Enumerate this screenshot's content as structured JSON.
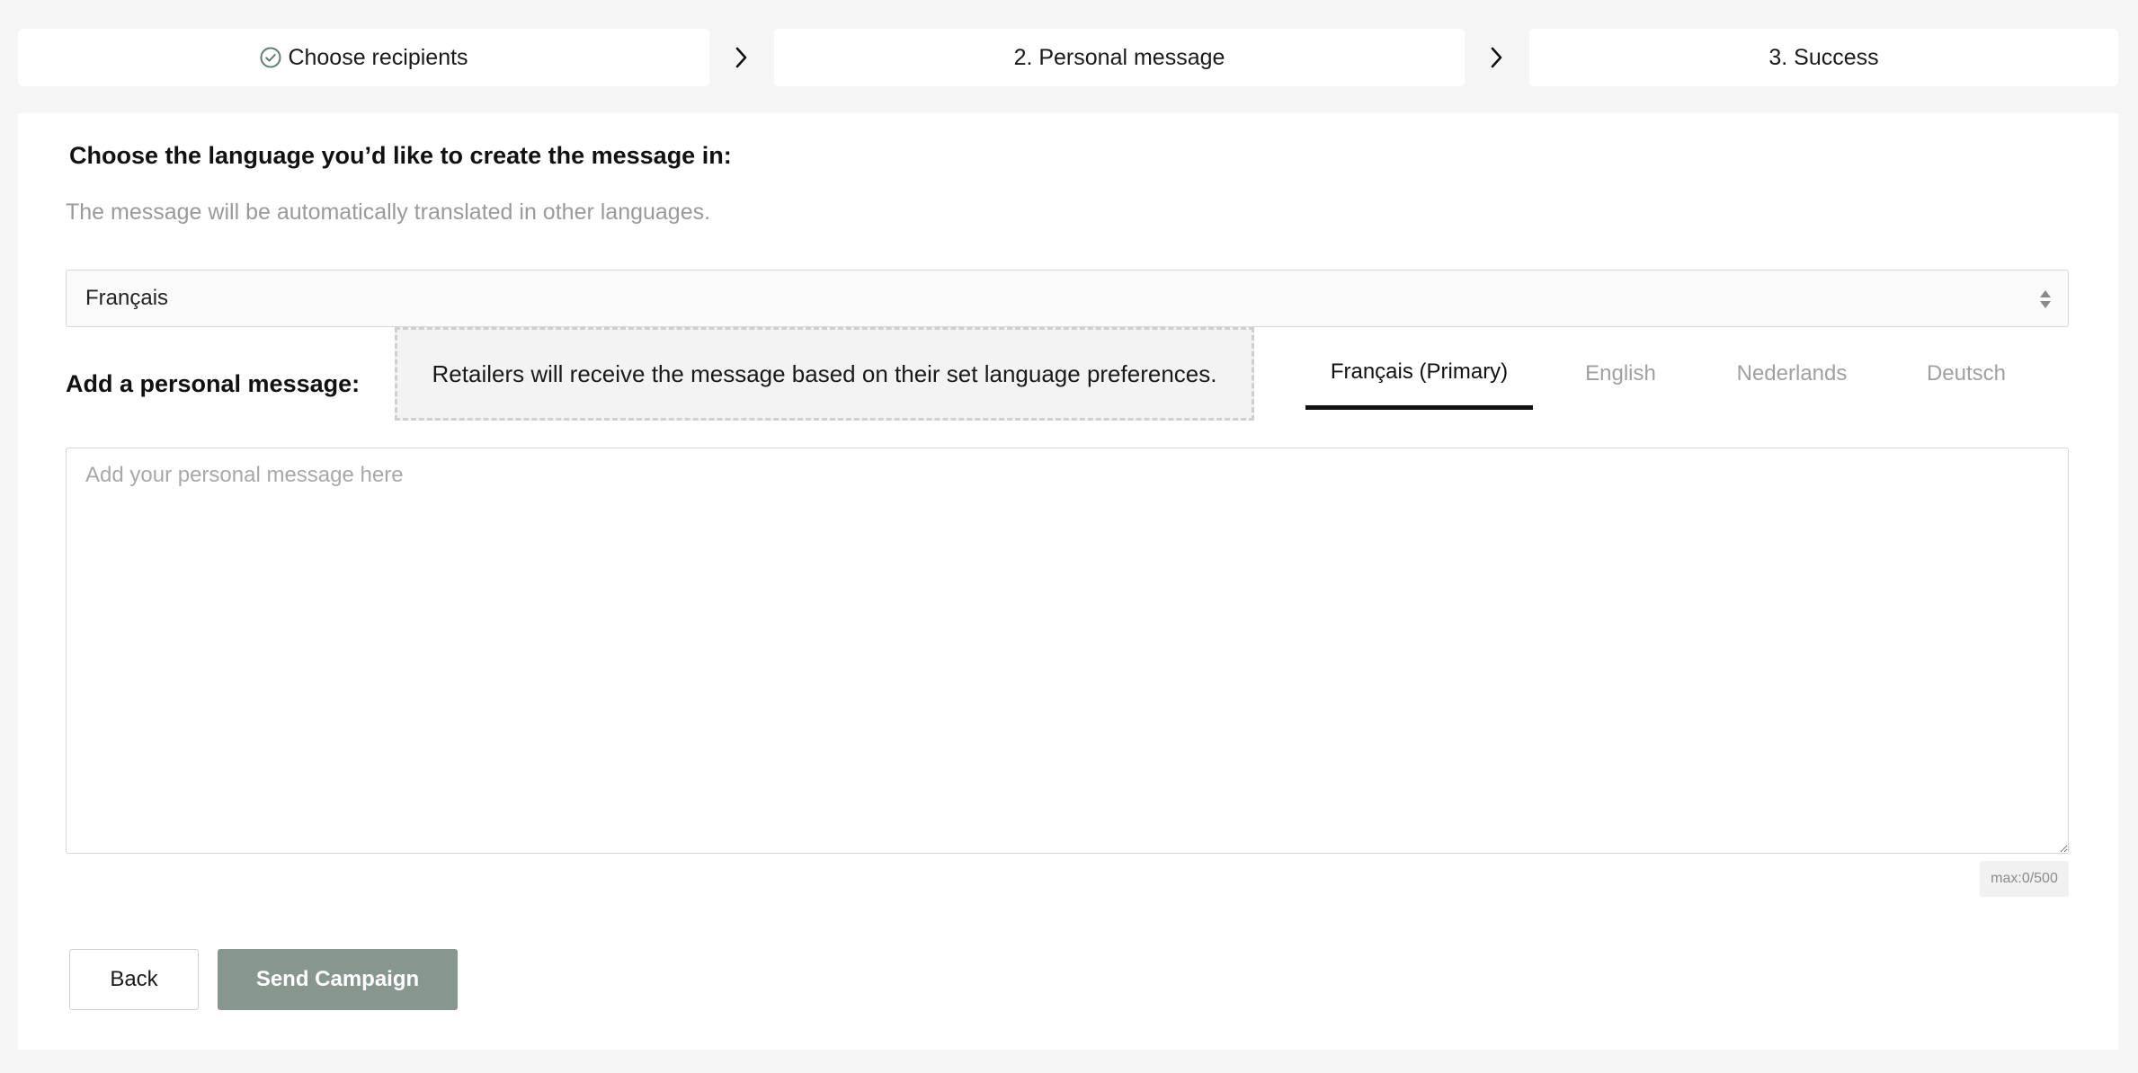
{
  "stepper": {
    "steps": [
      {
        "label": "Choose recipients",
        "completed": true
      },
      {
        "label": "2. Personal message",
        "completed": false
      },
      {
        "label": "3. Success",
        "completed": false
      }
    ]
  },
  "language": {
    "heading": "Choose the language you’d like to create the message in:",
    "subtext": "The message will be automatically translated in other languages.",
    "selected": "Français"
  },
  "message": {
    "label": "Add a personal message:",
    "info": "Retailers will receive the message based on their set language preferences.",
    "tabs": [
      {
        "label": "Français (Primary)",
        "active": true
      },
      {
        "label": "English",
        "active": false
      },
      {
        "label": "Nederlands",
        "active": false
      },
      {
        "label": "Deutsch",
        "active": false
      }
    ],
    "placeholder": "Add your personal message here",
    "counter": "max:0/500"
  },
  "actions": {
    "back_label": "Back",
    "send_label": "Send Campaign"
  },
  "colors": {
    "accent": "#879790",
    "check": "#5e7d72",
    "background": "#f5f5f6"
  }
}
